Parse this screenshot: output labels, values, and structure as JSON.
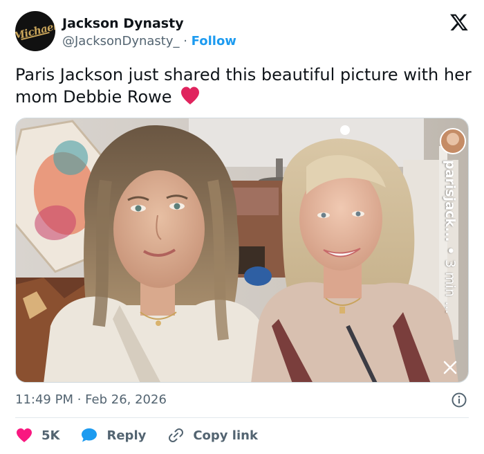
{
  "author": {
    "display_name": "Jackson Dynasty",
    "handle": "@JacksonDynasty_",
    "separator": " · ",
    "follow_label": "Follow",
    "avatar_text": "Michael"
  },
  "tweet": {
    "text": "Paris Jackson just shared this beautiful picture with her mom Debbie Rowe",
    "emoji": "heart-emoji"
  },
  "media": {
    "overlay_username": "parisjack...",
    "overlay_time": "3 min",
    "overlay_more": "...",
    "overlay_close": "X"
  },
  "meta": {
    "time": "11:49 PM",
    "separator": " · ",
    "date": "Feb 26, 2026"
  },
  "actions": {
    "likes": "5K",
    "reply_label": "Reply",
    "copy_label": "Copy link"
  },
  "colors": {
    "accent": "#1d9bf0",
    "like": "#f91880",
    "muted": "#536471",
    "heart": "#e0245e"
  }
}
